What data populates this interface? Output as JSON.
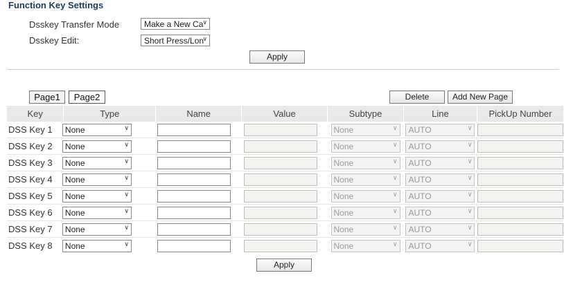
{
  "title": "Function Key Settings",
  "settings": {
    "transfer_mode_label": "Dsskey Transfer Mode",
    "transfer_mode_value": "Make a New Ca",
    "edit_label": "Dsskey Edit:",
    "edit_value": "Short Press/Lon",
    "apply_label": "Apply"
  },
  "pages": {
    "page1_label": "Page1",
    "page2_label": "Page2"
  },
  "actions": {
    "delete_label": "Delete",
    "add_page_label": "Add New Page",
    "apply_label": "Apply"
  },
  "table": {
    "headers": [
      "Key",
      "Type",
      "Name",
      "Value",
      "Subtype",
      "Line",
      "PickUp Number"
    ],
    "rows": [
      {
        "key": "DSS Key 1",
        "type": "None",
        "name": "",
        "value": "",
        "subtype": "None",
        "line": "AUTO",
        "pickup": ""
      },
      {
        "key": "DSS Key 2",
        "type": "None",
        "name": "",
        "value": "",
        "subtype": "None",
        "line": "AUTO",
        "pickup": ""
      },
      {
        "key": "DSS Key 3",
        "type": "None",
        "name": "",
        "value": "",
        "subtype": "None",
        "line": "AUTO",
        "pickup": ""
      },
      {
        "key": "DSS Key 4",
        "type": "None",
        "name": "",
        "value": "",
        "subtype": "None",
        "line": "AUTO",
        "pickup": ""
      },
      {
        "key": "DSS Key 5",
        "type": "None",
        "name": "",
        "value": "",
        "subtype": "None",
        "line": "AUTO",
        "pickup": ""
      },
      {
        "key": "DSS Key 6",
        "type": "None",
        "name": "",
        "value": "",
        "subtype": "None",
        "line": "AUTO",
        "pickup": ""
      },
      {
        "key": "DSS Key 7",
        "type": "None",
        "name": "",
        "value": "",
        "subtype": "None",
        "line": "AUTO",
        "pickup": ""
      },
      {
        "key": "DSS Key 8",
        "type": "None",
        "name": "",
        "value": "",
        "subtype": "None",
        "line": "AUTO",
        "pickup": ""
      }
    ]
  },
  "icons": {
    "dropdown": "chevron-down-icon"
  }
}
